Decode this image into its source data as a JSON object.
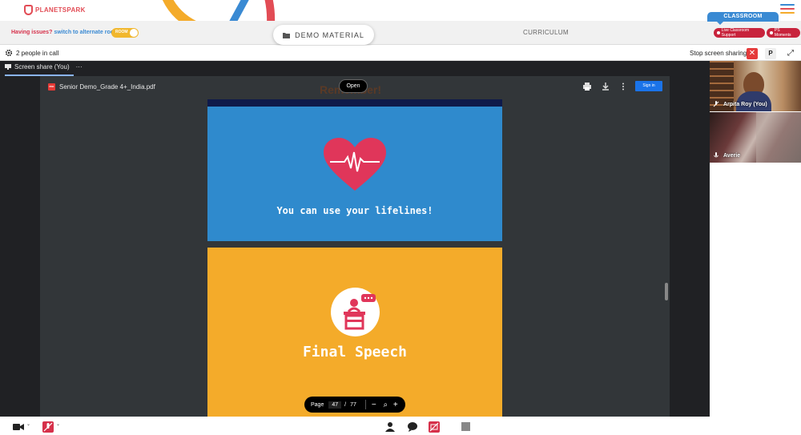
{
  "brand": {
    "name": "PLANETSPARK",
    "accent": "#e24c55",
    "blue": "#3a8ad3"
  },
  "header": {
    "issues_text": "Having issues?",
    "switch_link": "switch to alternate room",
    "room_toggle": "ROOM",
    "demo_material": "DEMO MATERIAL",
    "curriculum": "CURRICULUM",
    "classroom": "CLASSROOM",
    "live_support": "Live Classroom Support",
    "ps_moments": "PS Moments"
  },
  "call": {
    "people_count": "2 people in call",
    "stop_sharing": "Stop screen sharing",
    "p_button": "P",
    "screen_share_tab": "Screen share (You)",
    "more": "···"
  },
  "pdf": {
    "badge": "PDF",
    "filename": "Senior Demo_Grade 4+_India.pdf",
    "open": "Open",
    "sign_in": "Sign in",
    "behind_text": "Remember!",
    "slide1_text": "You can use your lifelines!",
    "slide2_text": "Final Speech",
    "page_label": "Page",
    "current_page": "47",
    "page_sep": "/",
    "total_pages": "77"
  },
  "participants": [
    {
      "name": "Arpita Roy (You)",
      "icon": "mic-off-icon"
    },
    {
      "name": "Averie",
      "icon": "mic-icon"
    }
  ],
  "colors": {
    "slide1": "#2f8acd",
    "slide2": "#f4ab2a",
    "heart": "#e0365a",
    "stop": "#e53a3a"
  }
}
